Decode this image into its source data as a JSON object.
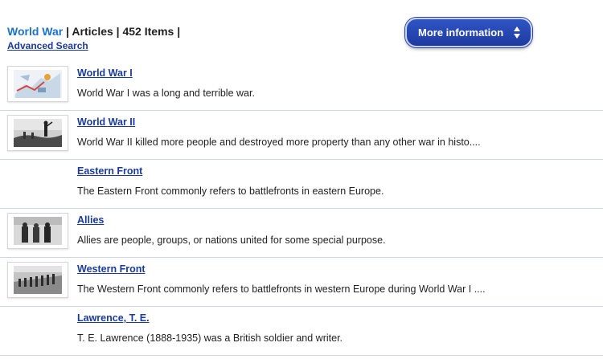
{
  "header": {
    "topic": "World War",
    "separator": "|",
    "section": "Articles",
    "count": "452 Items",
    "advanced_search": "Advanced Search"
  },
  "more_button": {
    "label": "More information",
    "icon": "up-down-arrows-icon"
  },
  "items": [
    {
      "title": "World War I",
      "description": "World War I was a long and terrible war.",
      "thumbnail": "map-illustration"
    },
    {
      "title": "World War II",
      "description": "World War II killed more people and destroyed more property than any other war in histo....",
      "thumbnail": "soldiers-photo"
    },
    {
      "title": "Eastern Front",
      "description": "The Eastern Front commonly refers to battlefronts in eastern Europe."
    },
    {
      "title": "Allies",
      "description": "Allies are people, groups, or nations united for some special purpose.",
      "thumbnail": "leaders-photo"
    },
    {
      "title": "Western Front",
      "description": "The Western Front commonly refers to battlefronts in western Europe during World War I ....",
      "thumbnail": "troops-march-photo"
    },
    {
      "title": "Lawrence, T. E.",
      "description": "T. E. Lawrence (1888-1935) was a British soldier and writer."
    }
  ],
  "colors": {
    "topic_link": "#1c72c8",
    "link": "#1a3a9e",
    "button": "#1e3aa0",
    "divider": "#cfd6e6"
  }
}
